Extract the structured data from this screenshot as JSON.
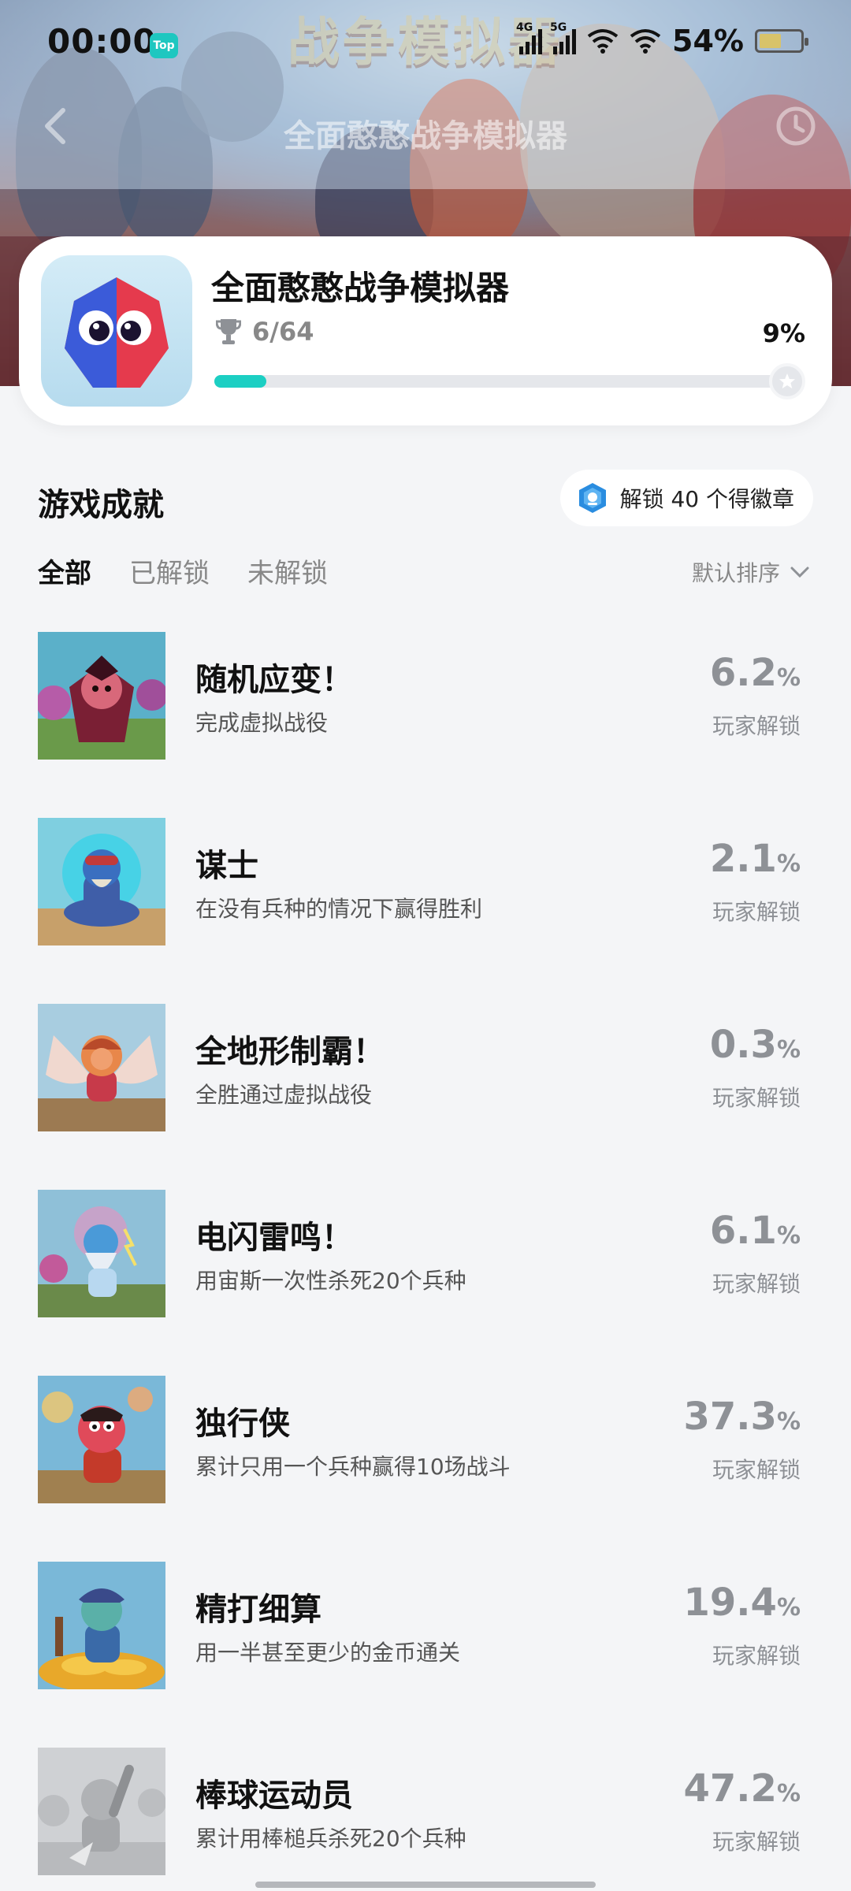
{
  "status_bar": {
    "time": "00:00",
    "top_badge": "Top",
    "net1": "4G",
    "net2": "5G",
    "battery": "54%"
  },
  "nav": {
    "title": "全面憨憨战争模拟器"
  },
  "game": {
    "title": "全面憨憨战争模拟器",
    "unlocked": 6,
    "total": 64,
    "progress_text": "6/64",
    "percent_text": "9%",
    "progress_fraction": 0.09
  },
  "section": {
    "title": "游戏成就",
    "badge_text": "解锁 40 个得徽章"
  },
  "tabs": [
    {
      "label": "全部",
      "active": true
    },
    {
      "label": "已解锁",
      "active": false
    },
    {
      "label": "未解锁",
      "active": false
    }
  ],
  "sort": {
    "label": "默认排序"
  },
  "achievements": [
    {
      "name": "随机应变！",
      "desc": "完成虚拟战役",
      "rate": "6.2",
      "pct": "%",
      "rate_label": "玩家解锁",
      "thumb": "vampire-character",
      "locked": false
    },
    {
      "name": "谋士",
      "desc": "在没有兵种的情况下赢得胜利",
      "rate": "2.1",
      "pct": "%",
      "rate_label": "玩家解锁",
      "thumb": "meditating-monk",
      "locked": false
    },
    {
      "name": "全地形制霸！",
      "desc": "全胜通过虚拟战役",
      "rate": "0.3",
      "pct": "%",
      "rate_label": "玩家解锁",
      "thumb": "winged-warrior",
      "locked": false
    },
    {
      "name": "电闪雷鸣！",
      "desc": "用宙斯一次性杀死20个兵种",
      "rate": "6.1",
      "pct": "%",
      "rate_label": "玩家解锁",
      "thumb": "zeus",
      "locked": false
    },
    {
      "name": "独行侠",
      "desc": "累计只用一个兵种赢得10场战斗",
      "rate": "37.3",
      "pct": "%",
      "rate_label": "玩家解锁",
      "thumb": "lone-hero",
      "locked": false
    },
    {
      "name": "精打细算",
      "desc": "用一半甚至更少的金币通关",
      "rate": "19.4",
      "pct": "%",
      "rate_label": "玩家解锁",
      "thumb": "gold-pile",
      "locked": false
    },
    {
      "name": "棒球运动员",
      "desc": "累计用棒槌兵杀死20个兵种",
      "rate": "47.2",
      "pct": "%",
      "rate_label": "玩家解锁",
      "thumb": "baseball-player",
      "locked": true
    }
  ],
  "colors": {
    "accent": "#1ccfc3",
    "background": "#f4f5f7",
    "rate_text": "#8e9196"
  }
}
